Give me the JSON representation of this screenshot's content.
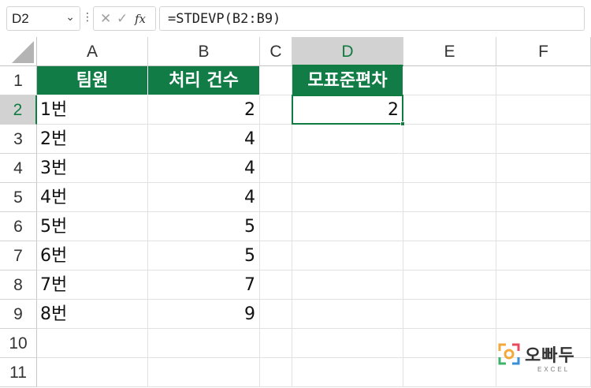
{
  "formula_bar": {
    "name_box": "D2",
    "formula": "=STDEVP(B2:B9)",
    "fx_label": "fx"
  },
  "columns": [
    "A",
    "B",
    "C",
    "D",
    "E",
    "F"
  ],
  "rows": [
    "1",
    "2",
    "3",
    "4",
    "5",
    "6",
    "7",
    "8",
    "9",
    "10",
    "11"
  ],
  "selected_cell": "D2",
  "cells": {
    "A1": "팀원",
    "B1": "처리 건수",
    "D1": "모표준편차",
    "A2": "1번",
    "B2": "2",
    "D2": "2",
    "A3": "2번",
    "B3": "4",
    "A4": "3번",
    "B4": "4",
    "A5": "4번",
    "B5": "4",
    "A6": "5번",
    "B6": "5",
    "A7": "6번",
    "B7": "5",
    "A8": "7번",
    "B8": "7",
    "A9": "8번",
    "B9": "9"
  },
  "colors": {
    "header_fill": "#127c47",
    "selection": "#107c41"
  },
  "logo": {
    "word": "오빠두",
    "sub": "EXCEL"
  }
}
